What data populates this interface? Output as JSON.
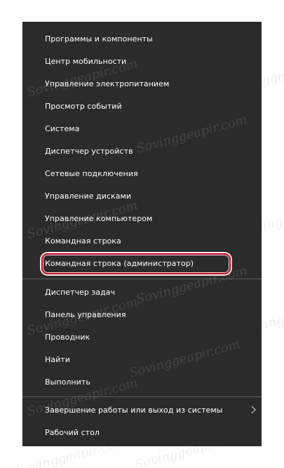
{
  "menu": {
    "group1": [
      "Программы и компоненты",
      "Центр мобильности",
      "Управление электропитанием",
      "Просмотр событий",
      "Система",
      "Диспетчер устройств",
      "Сетевые подключения",
      "Управление дисками",
      "Управление компьютером",
      "Командная строка",
      "Командная строка (администратор)"
    ],
    "group2": [
      "Диспетчер задач",
      "Панель управления",
      "Проводник",
      "Найти",
      "Выполнить"
    ],
    "group3": [
      "Завершение работы или выход из системы",
      "Рабочий стол"
    ],
    "highlighted_item": "Командная строка (администратор)"
  },
  "watermark": "Sovinggeapir.com",
  "colors": {
    "menu_bg": "#2b2b2b",
    "text": "#ffffff",
    "highlight_border": "#d8001f",
    "separator": "#5a5a5a"
  },
  "icons": {
    "submenu": "chevron-right-icon"
  }
}
